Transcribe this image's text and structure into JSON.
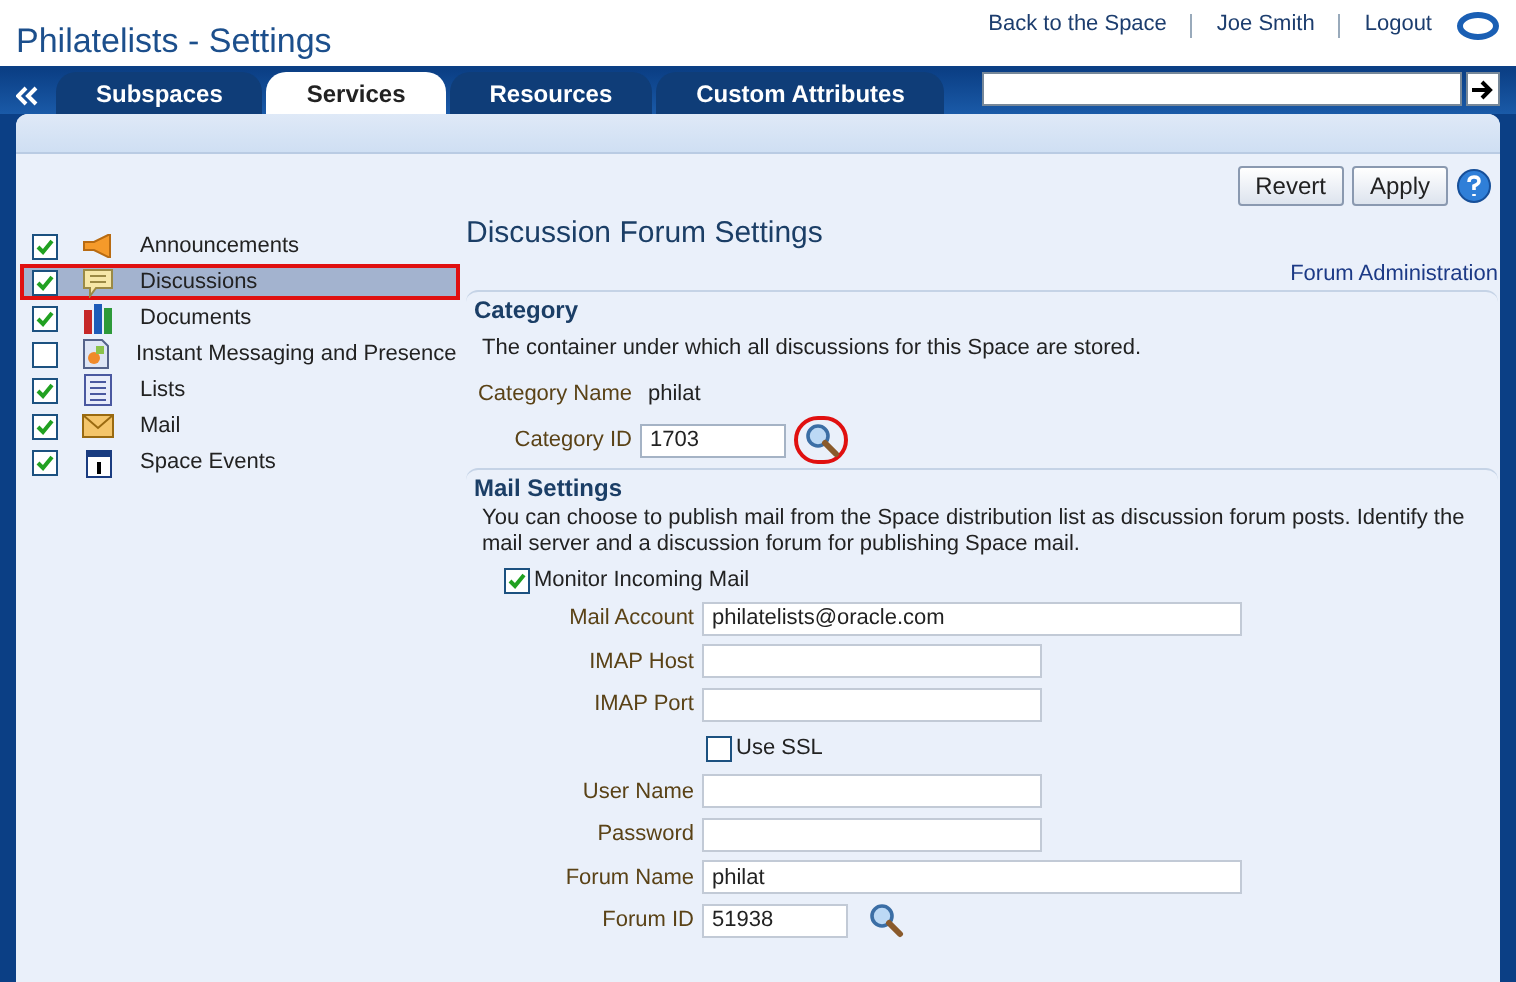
{
  "header": {
    "title": "Philatelists - Settings",
    "links": [
      "Back to the Space",
      "Joe Smith",
      "Logout"
    ]
  },
  "tabs": [
    {
      "label": "Subspaces",
      "selected": false
    },
    {
      "label": "Services",
      "selected": true
    },
    {
      "label": "Resources",
      "selected": false
    },
    {
      "label": "Custom Attributes",
      "selected": false
    }
  ],
  "toolbar": {
    "buttons": [
      "Revert",
      "Apply"
    ]
  },
  "services": [
    {
      "label": "Announcements",
      "checked": true,
      "selected": false,
      "annotated": false,
      "kind": "megaphone"
    },
    {
      "label": "Discussions",
      "checked": true,
      "selected": true,
      "annotated": true,
      "kind": "speech"
    },
    {
      "label": "Documents",
      "checked": true,
      "selected": false,
      "annotated": false,
      "kind": "books"
    },
    {
      "label": "Instant Messaging and Presence",
      "checked": false,
      "selected": false,
      "annotated": false,
      "kind": "im"
    },
    {
      "label": "Lists",
      "checked": true,
      "selected": false,
      "annotated": false,
      "kind": "list"
    },
    {
      "label": "Mail",
      "checked": true,
      "selected": false,
      "annotated": false,
      "kind": "mail"
    },
    {
      "label": "Space Events",
      "checked": true,
      "selected": false,
      "annotated": false,
      "kind": "calendar"
    }
  ],
  "settings": {
    "title": "Discussion Forum Settings",
    "admin_link": "Forum Administration",
    "category": {
      "heading": "Category",
      "description": "The container under which all discussions for this Space are stored.",
      "name_label": "Category Name",
      "name_value": "philat",
      "id_label": "Category ID",
      "id_value": "1703",
      "lookup_annotated": true
    },
    "mail": {
      "heading": "Mail Settings",
      "description": "You can choose to publish mail from the Space distribution list as discussion forum posts. Identify the mail server and a discussion forum for publishing Space mail.",
      "monitor": {
        "label": "Monitor Incoming Mail",
        "checked": true
      },
      "fields": [
        {
          "kind": "long_field",
          "label": "Mail Account",
          "value": "philatelists@oracle.com"
        },
        {
          "kind": "field",
          "label": "IMAP Host"
        },
        {
          "kind": "field",
          "label": "IMAP Port"
        },
        {
          "kind": "checkbox",
          "label": "Use SSL",
          "checked": false
        },
        {
          "kind": "field",
          "label": "User Name"
        },
        {
          "kind": "field",
          "label": "Password"
        },
        {
          "kind": "long_field",
          "label": "Forum Name",
          "value": "philat"
        },
        {
          "kind": "lookup_field",
          "label": "Forum ID",
          "value": "51938"
        }
      ]
    }
  }
}
